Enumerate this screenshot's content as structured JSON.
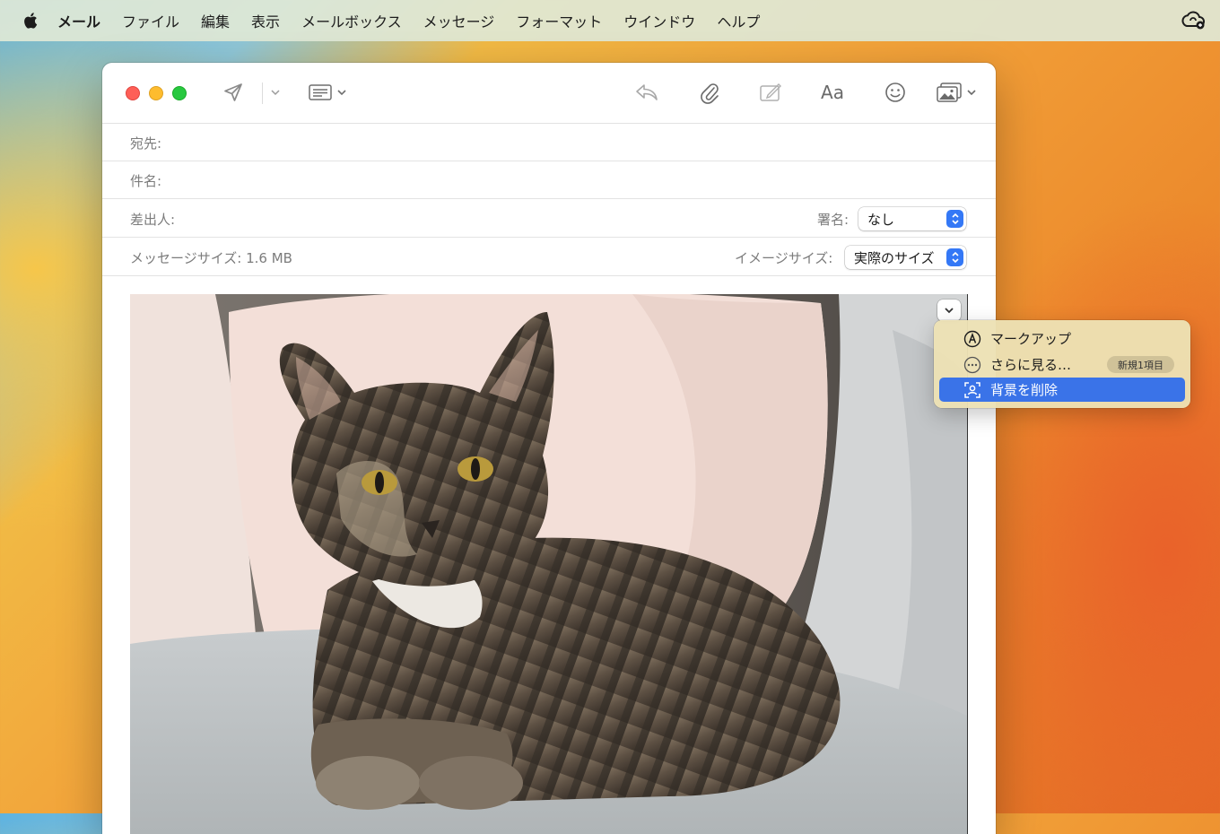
{
  "menubar": {
    "apple_icon": "apple-logo-icon",
    "app_name": "メール",
    "items": [
      "ファイル",
      "編集",
      "表示",
      "メールボックス",
      "メッセージ",
      "フォーマット",
      "ウインドウ",
      "ヘルプ"
    ],
    "status_icon": "creative-cloud-icon"
  },
  "toolbar": {
    "icons": [
      "send-icon",
      "chevron-down-icon",
      "header-fields-icon",
      "reply-icon",
      "attach-icon",
      "markup-icon",
      "font-icon",
      "emoji-icon",
      "photo-browser-icon"
    ],
    "font_label": "Aa"
  },
  "fields": {
    "to_label": "宛先:",
    "subject_label": "件名:",
    "from_label": "差出人:",
    "signature_label": "署名:",
    "signature_value": "なし",
    "message_size_label": "メッセージサイズ:",
    "message_size_value": "1.6 MB",
    "image_size_label": "イメージサイズ:",
    "image_size_value": "実際のサイズ"
  },
  "context_menu": {
    "items": [
      {
        "icon": "markup-a-icon",
        "label": "マークアップ"
      },
      {
        "icon": "more-ellipsis-icon",
        "label": "さらに見る…",
        "badge": "新規1項目"
      },
      {
        "icon": "remove-background-icon",
        "label": "背景を削除",
        "selected": true
      }
    ]
  },
  "colors": {
    "accent": "#3a73e8",
    "stepper": "#3478f6"
  }
}
